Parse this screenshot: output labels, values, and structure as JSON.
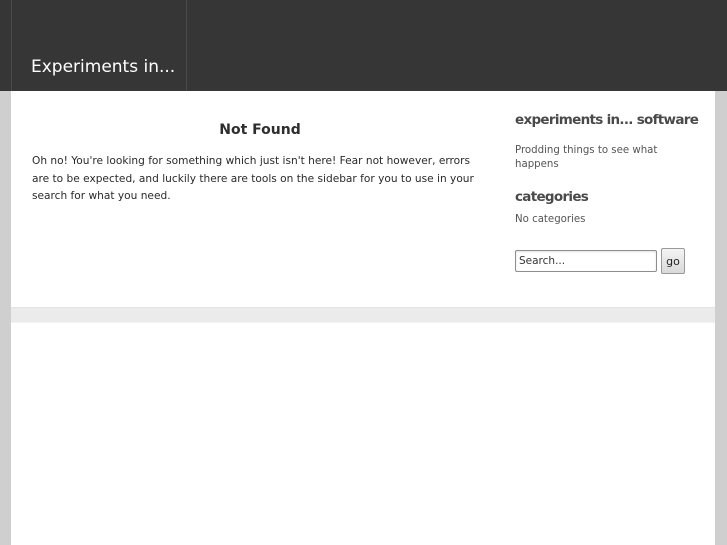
{
  "header": {
    "site_title": "Experiments in..."
  },
  "main": {
    "heading": "Not Found",
    "message": "Oh no! You're looking for something which just isn't here! Fear not however, errors are to be expected, and luckily there are tools on the sidebar for you to use in your search for what you need."
  },
  "sidebar": {
    "about_title": "experiments in... software",
    "about_text": "Prodding things to see what happens",
    "categories_title": "categories",
    "categories_text": "No categories",
    "search": {
      "placeholder": "Search...",
      "button_label": "go"
    }
  },
  "colors": {
    "header_background": "#363636",
    "page_background": "#cfcfcf",
    "content_background": "#ffffff"
  }
}
